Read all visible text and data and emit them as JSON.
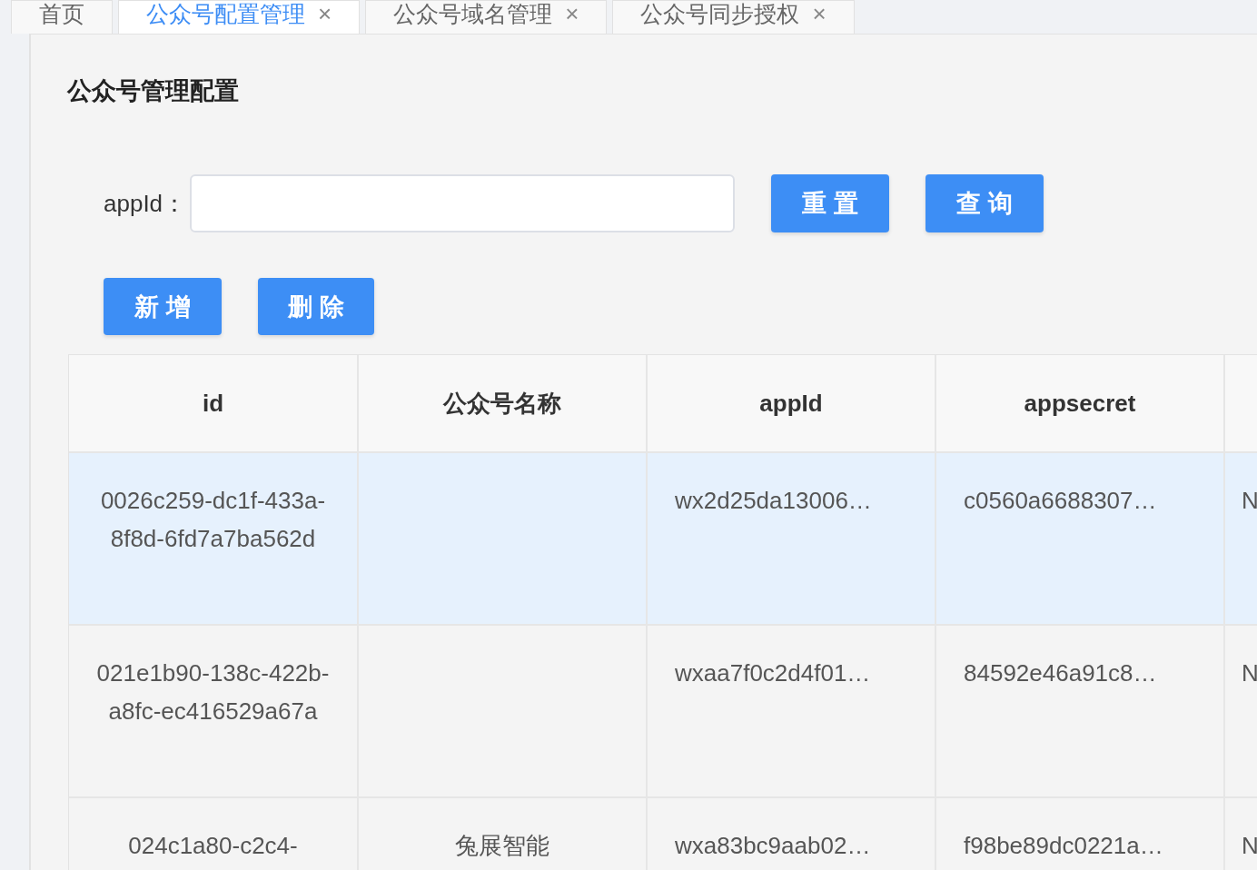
{
  "tabs": [
    {
      "label": "首页",
      "selected": false
    },
    {
      "label": "公众号配置管理",
      "close": "×",
      "selected": true
    },
    {
      "label": "公众号域名管理",
      "close": "×",
      "selected": false
    },
    {
      "label": "公众号同步授权",
      "close": "×",
      "selected": false
    }
  ],
  "page_title": "公众号管理配置",
  "search": {
    "label": "appId："
  },
  "search_buttons": [
    "重 置",
    "查 询"
  ],
  "action_buttons": [
    "新 增",
    "删 除"
  ],
  "table": {
    "columns": [
      "id",
      "公众号名称",
      "appId",
      "appsecret",
      ""
    ],
    "rows": [
      {
        "selected": true,
        "cells": [
          "0026c259-dc1f-433a-8f8d-6fd7a7ba562d",
          "",
          "wx2d25da13006…",
          "c0560a6688307…",
          "N"
        ]
      },
      {
        "selected": false,
        "cells": [
          "021e1b90-138c-422b-a8fc-ec416529a67a",
          "",
          "wxaa7f0c2d4f01…",
          "84592e46a91c8…",
          "N"
        ]
      },
      {
        "selected": false,
        "cells": [
          "024c1a80-c2c4-",
          "兔展智能",
          "wxa83bc9aab02…",
          "f98be89dc0221a…",
          "N"
        ]
      }
    ]
  }
}
